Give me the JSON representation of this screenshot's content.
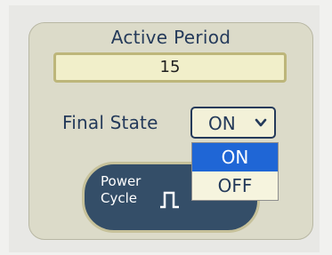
{
  "active_period": {
    "label": "Active Period",
    "value": "15"
  },
  "final_state": {
    "label": "Final State",
    "selected": "ON",
    "options": [
      "ON",
      "OFF"
    ],
    "highlighted_option": "ON"
  },
  "power_cycle_button": {
    "line1": "Power",
    "line2": "Cycle",
    "icon": "pulse-icon"
  },
  "colors": {
    "label_text": "#243a5a",
    "field_background": "#f1efca",
    "field_border": "#bdb67a",
    "card_background": "#dcdbc9",
    "button_background": "#344e68",
    "dropdown_highlight": "#1f66d6"
  }
}
